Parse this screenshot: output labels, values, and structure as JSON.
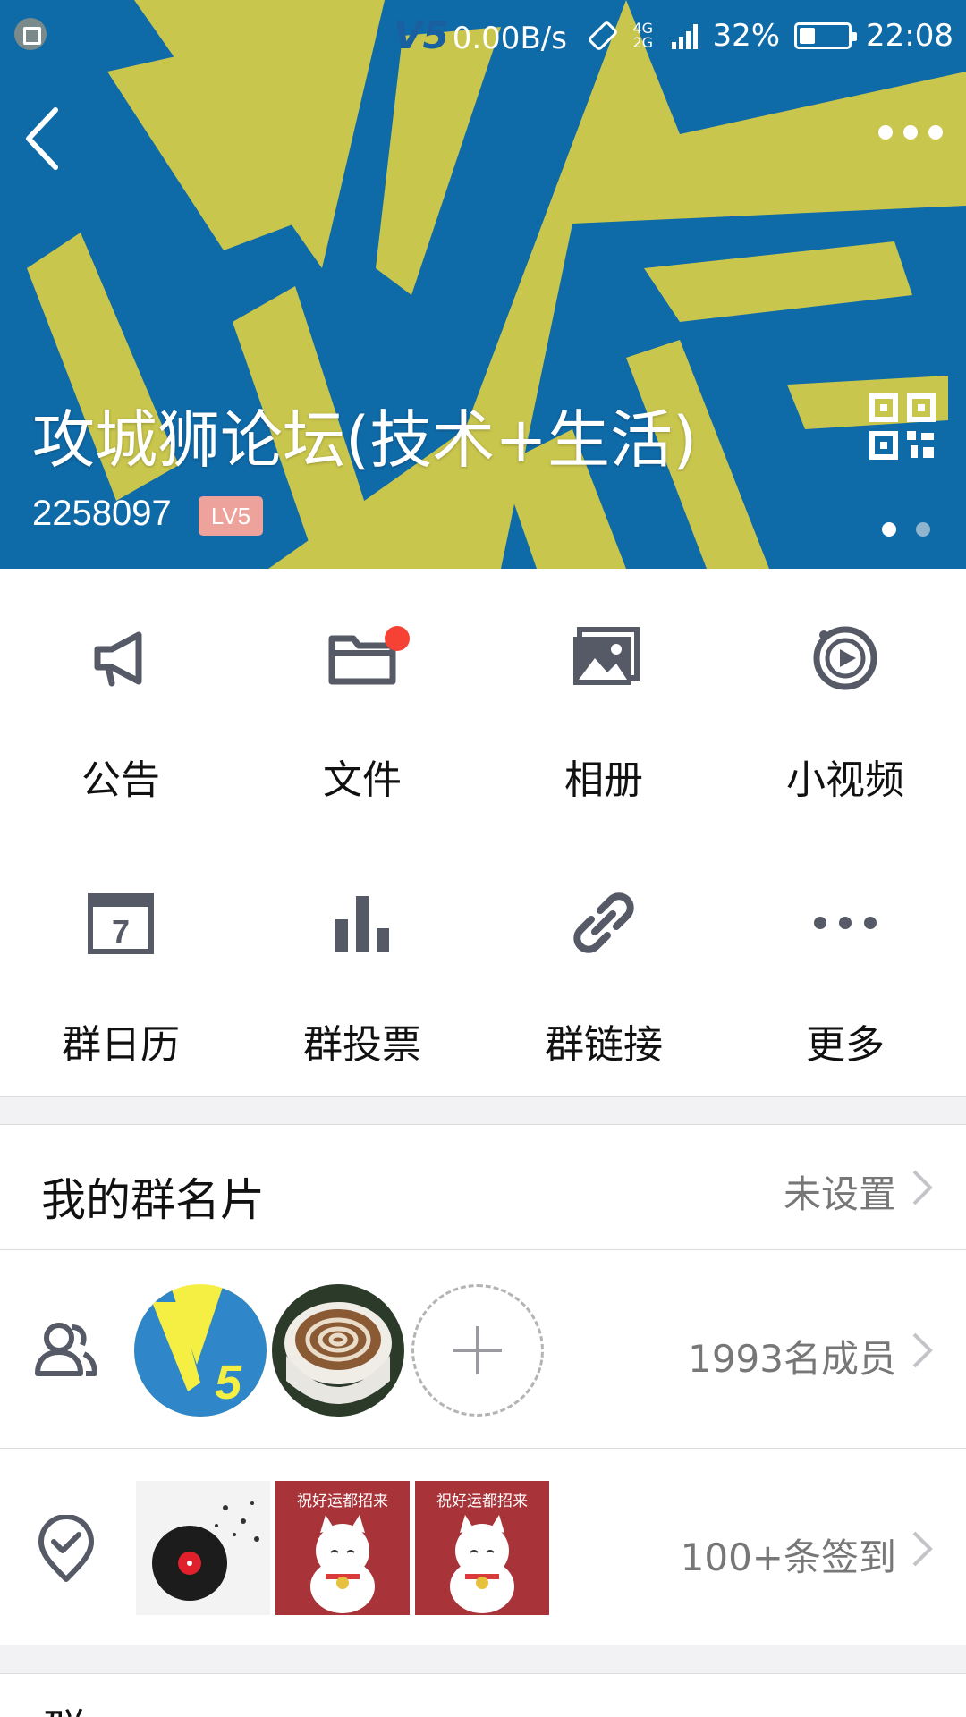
{
  "status_bar": {
    "net_speed": "0.00B/s",
    "network": [
      "4G",
      "2G"
    ],
    "battery_percent": "32%",
    "battery_level": 0.32,
    "time": "22:08"
  },
  "header": {
    "group_name": "攻城狮论坛(技术+生活)",
    "group_id": "2258097",
    "level": "LV5",
    "pages": 2,
    "active_page": 1,
    "banner_colors": {
      "yellow": "#c9c64d",
      "blue": "#0f6aa8"
    }
  },
  "features": [
    {
      "label": "公告",
      "icon": "megaphone-icon"
    },
    {
      "label": "文件",
      "icon": "folder-icon",
      "badge": true
    },
    {
      "label": "相册",
      "icon": "photo-album-icon"
    },
    {
      "label": "小视频",
      "icon": "video-play-icon"
    },
    {
      "label": "群日历",
      "icon": "calendar-icon",
      "icon_text": "7"
    },
    {
      "label": "群投票",
      "icon": "bar-chart-icon"
    },
    {
      "label": "群链接",
      "icon": "link-icon"
    },
    {
      "label": "更多",
      "icon": "more-dots-icon"
    }
  ],
  "my_card": {
    "title": "我的群名片",
    "value": "未设置"
  },
  "members": {
    "count_label": "1993名成员",
    "icon": "members-icon"
  },
  "signin": {
    "count_label": "100+条签到",
    "icon": "location-check-icon",
    "thumb_text": "祝好运都招来"
  },
  "next_row": {
    "title": "群…"
  },
  "colors": {
    "icon_gray": "#555a66",
    "badge_red": "#f54234",
    "level_badge": "#eda39c",
    "secondary_text": "#777777"
  }
}
